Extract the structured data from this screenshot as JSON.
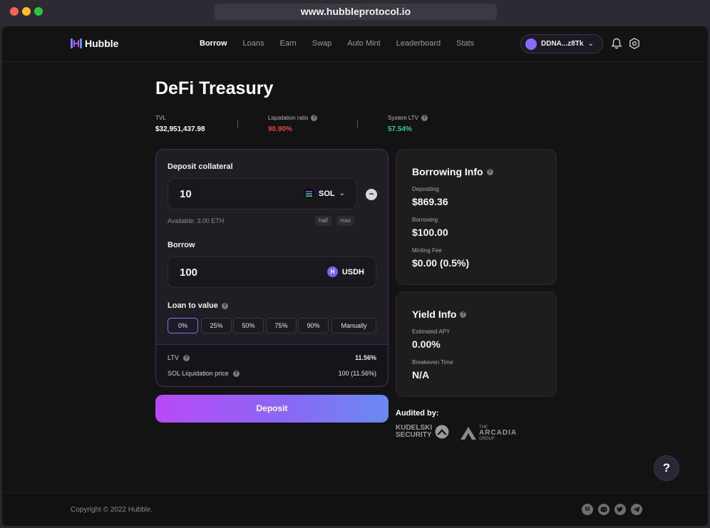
{
  "browser": {
    "url": "www.hubbleprotocol.io"
  },
  "nav": {
    "brand": "Hubble",
    "links": [
      "Borrow",
      "Loans",
      "Earn",
      "Swap",
      "Auto Mint",
      "Leaderboard",
      "Stats"
    ],
    "active": "Borrow",
    "wallet": "DDNA...z8Tk"
  },
  "page": {
    "title": "DeFi Treasury",
    "stats": {
      "tvl_label": "TVL",
      "tvl_value": "$32,951,437.98",
      "liq_label": "Liquidation ratio",
      "liq_value": "90.90%",
      "ltv_label": "System LTV",
      "ltv_value": "57.54%"
    }
  },
  "form": {
    "deposit_label": "Deposit collateral",
    "deposit_amount": "10",
    "deposit_token": "SOL",
    "available": "Available: 3.00 ETH",
    "half": "half",
    "max": "max",
    "borrow_label": "Borrow",
    "borrow_amount": "100",
    "borrow_token": "USDH",
    "ltv_label": "Loan to value",
    "ltv_options": [
      "0%",
      "25%",
      "50%",
      "75%",
      "90%",
      "Manually"
    ],
    "ltv_row_label": "LTV",
    "ltv_row_value": "11.56%",
    "liq_price_label": "SOL Liquidation price",
    "liq_price_value": "100 (11.56%)",
    "deposit_button": "Deposit"
  },
  "borrowing_info": {
    "title": "Borrowing Info",
    "depositing_label": "Depositing",
    "depositing_value": "$869.36",
    "borrowing_label": "Borrowing",
    "borrowing_value": "$100.00",
    "fee_label": "Minting Fee",
    "fee_value": "$0.00 (0.5%)"
  },
  "yield_info": {
    "title": "Yield Info",
    "apy_label": "Estimated APY",
    "apy_value": "0.00%",
    "breakeven_label": "Breakeven Time",
    "breakeven_value": "N/A"
  },
  "audits": {
    "label": "Audited by:",
    "kudelski_line1": "KUDELSKI",
    "kudelski_line2": "SECURITY",
    "arcadia_small": "THE",
    "arcadia": "ARCADIA",
    "arcadia_group": "GROUP"
  },
  "footer": {
    "copyright": "Copyright © 2022 Hubble."
  },
  "colors": {
    "red": "#e8473d",
    "green": "#2fd38f",
    "accent": "#8a74e8"
  },
  "icons": [
    "bell-icon",
    "gear-icon",
    "help-icon",
    "medium-icon",
    "discord-icon",
    "twitter-icon",
    "telegram-icon"
  ]
}
